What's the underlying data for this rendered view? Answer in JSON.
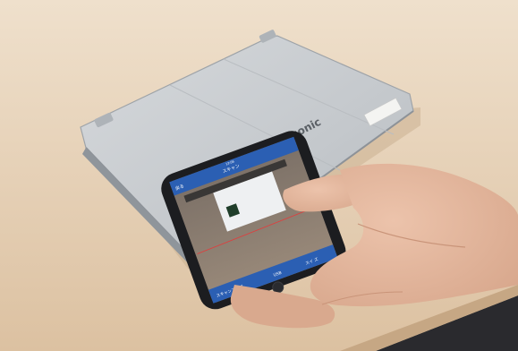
{
  "scene": {
    "laptop": {
      "brand_text": "Panasonic",
      "color_body": "#c9ccd0",
      "color_edge": "#9ea3a8"
    },
    "table": {
      "color_top": "#e7cfb2",
      "color_shadow": "#d8bd9c"
    },
    "phone": {
      "color_frame": "#1c1d20",
      "color_screen_header": "#2b5fb3",
      "header_time": "13:06",
      "screen_texts": {
        "back": "戻る",
        "title": "スキャン",
        "bottom_left": "スキャンアップ",
        "bottom_mid": "USB",
        "bottom_right": "スイ ズ"
      }
    },
    "hand": {
      "color_skin": "#e4b79e",
      "color_skin_shadow": "#cf9e84"
    },
    "floor_color": "#2a2a2e"
  }
}
